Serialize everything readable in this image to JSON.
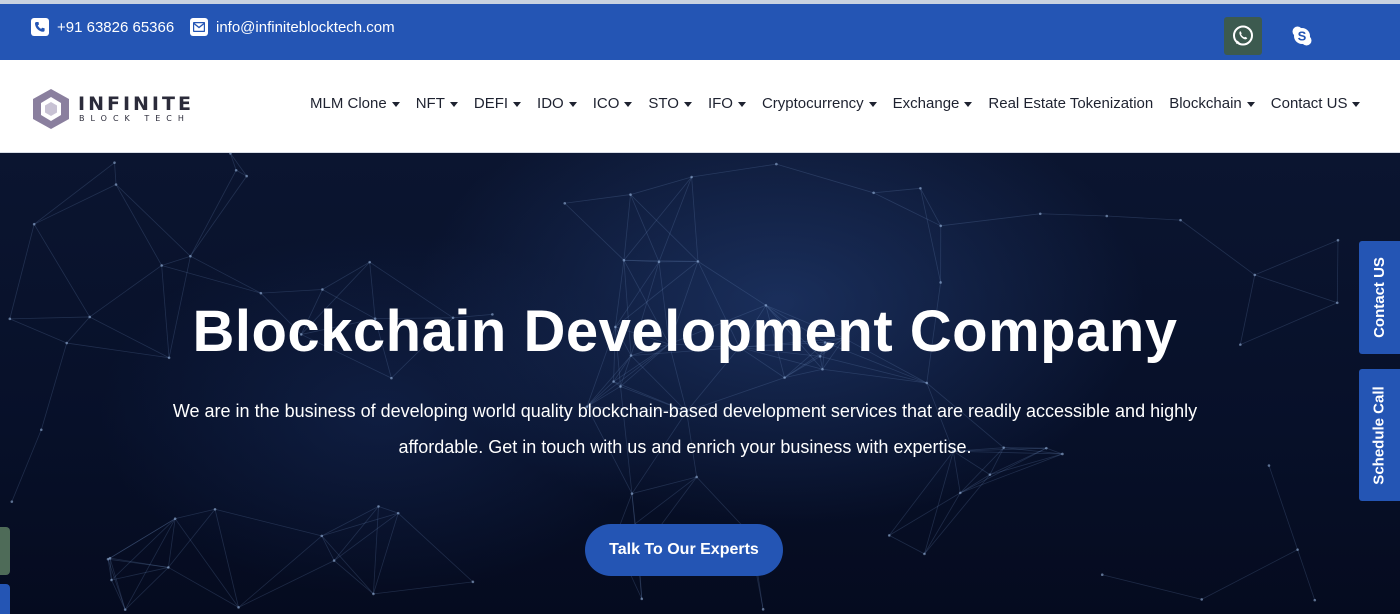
{
  "topbar": {
    "phone": "+91 63826 65366",
    "email": "info@infiniteblocktech.com",
    "phone_icon": "phone-icon",
    "email_icon": "envelope-icon",
    "social": [
      "whatsapp-icon",
      "skype-icon"
    ]
  },
  "logo": {
    "main": "INFINITE",
    "sub": "BLOCK TECH"
  },
  "nav": {
    "items": [
      {
        "label": "MLM Clone",
        "dropdown": true
      },
      {
        "label": "NFT",
        "dropdown": true
      },
      {
        "label": "DEFI",
        "dropdown": true
      },
      {
        "label": "IDO",
        "dropdown": true
      },
      {
        "label": "ICO",
        "dropdown": true
      },
      {
        "label": "STO",
        "dropdown": true
      },
      {
        "label": "IFO",
        "dropdown": true
      },
      {
        "label": "Cryptocurrency",
        "dropdown": true
      },
      {
        "label": "Exchange",
        "dropdown": true
      },
      {
        "label": "Real Estate Tokenization",
        "dropdown": false
      },
      {
        "label": "Blockchain",
        "dropdown": true
      },
      {
        "label": "Contact US",
        "dropdown": true
      }
    ]
  },
  "hero": {
    "title": "Blockchain Development Company",
    "description": "We are in the business of developing world quality blockchain-based development services that are readily accessible and highly affordable. Get in touch with us and enrich your business with expertise.",
    "cta_label": "Talk To Our Experts"
  },
  "side_tabs": {
    "contact": "Contact US",
    "schedule": "Schedule Call"
  },
  "colors": {
    "brand_blue": "#2455b4",
    "hero_bg": "#071029",
    "whatsapp_bg": "#3c5a4f"
  }
}
